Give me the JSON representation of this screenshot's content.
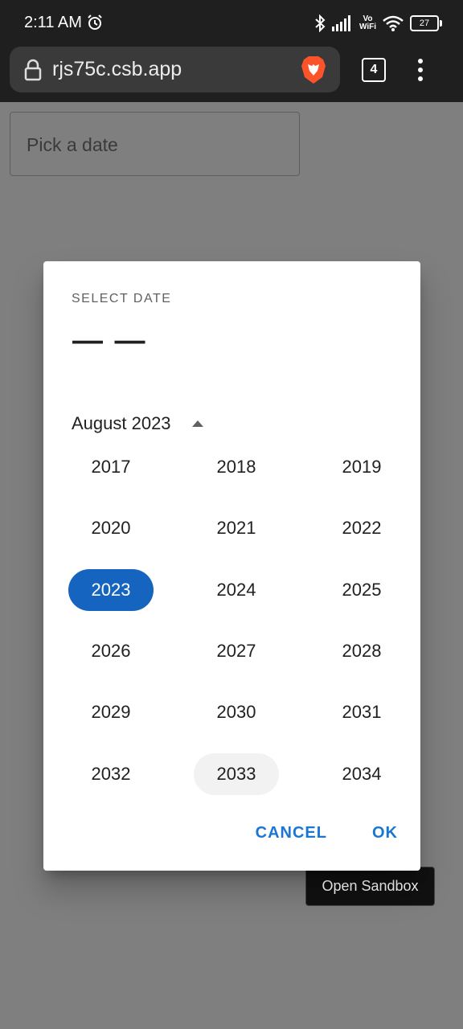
{
  "status_bar": {
    "time": "2:11 AM",
    "volte_top": "Vo",
    "volte_bottom": "WiFi",
    "battery": "27"
  },
  "browser": {
    "url": "rjs75c.csb.app",
    "tab_count": "4"
  },
  "page": {
    "date_field_placeholder": "Pick a date",
    "open_sandbox_label": "Open Sandbox"
  },
  "dialog": {
    "title": "SELECT DATE",
    "value": "— —",
    "month_label": "August 2023",
    "selected_year": "2023",
    "hover_year": "2033",
    "years": [
      "2017",
      "2018",
      "2019",
      "2020",
      "2021",
      "2022",
      "2023",
      "2024",
      "2025",
      "2026",
      "2027",
      "2028",
      "2029",
      "2030",
      "2031",
      "2032",
      "2033",
      "2034"
    ],
    "cancel_label": "CANCEL",
    "ok_label": "OK"
  },
  "colors": {
    "accent": "#1976d2",
    "selected_year_bg": "#1565c0",
    "status_bar_bg": "#1f1f1f"
  }
}
